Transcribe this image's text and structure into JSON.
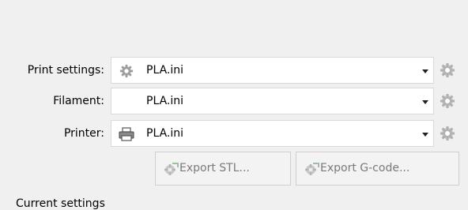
{
  "rows": [
    {
      "label": "Print settings:",
      "value": "PLA.ini",
      "icon": "gear-icon"
    },
    {
      "label": "Filament:",
      "value": "PLA.ini",
      "icon": ""
    },
    {
      "label": "Printer:",
      "value": "PLA.ini",
      "icon": "printer-icon"
    }
  ],
  "buttons": {
    "export_stl": "Export STL...",
    "export_gcode": "Export G-code..."
  },
  "cut_off_text": "Current settings"
}
